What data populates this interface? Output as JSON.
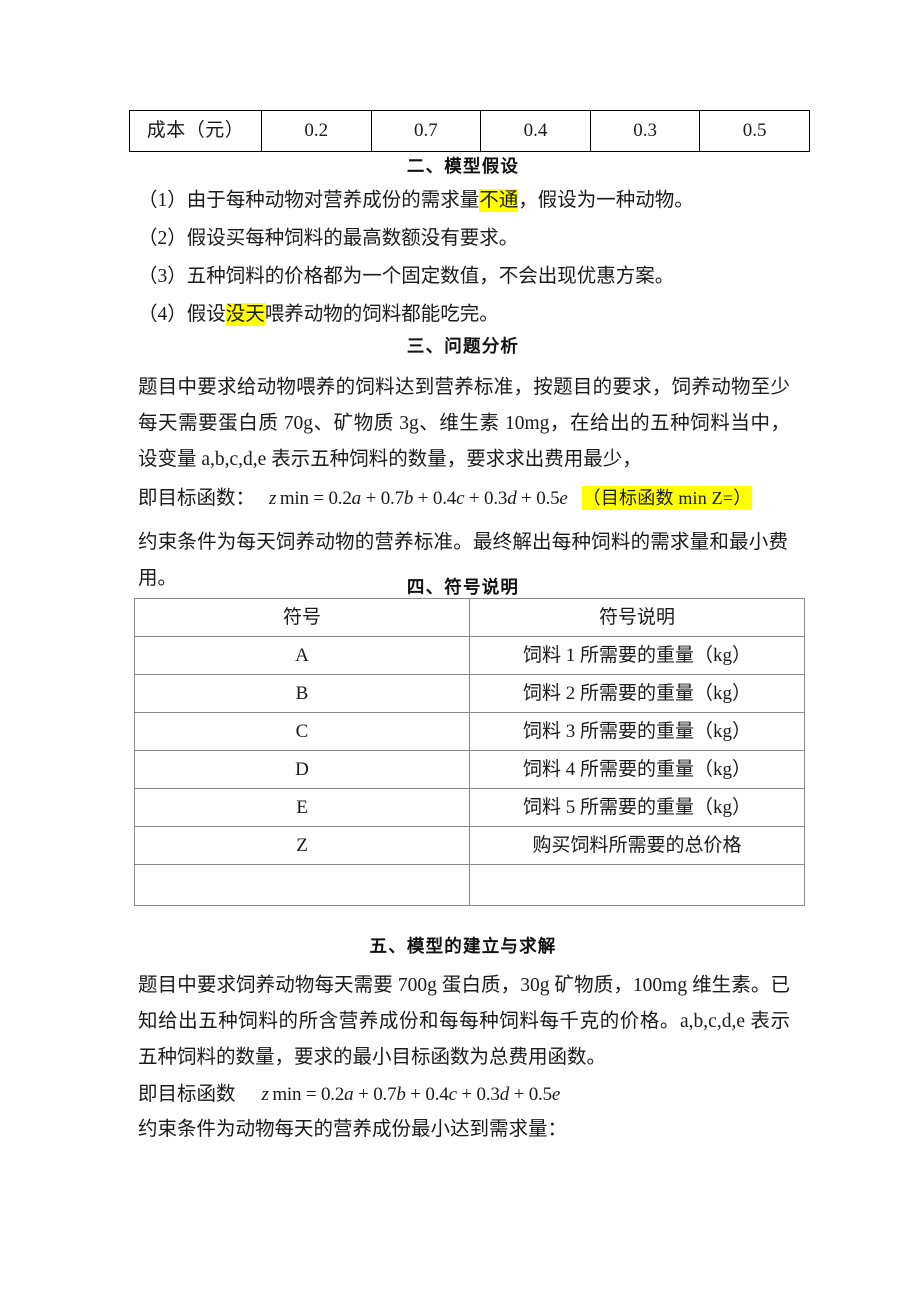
{
  "document": {
    "cost_table": {
      "row_label": "成本（元）",
      "values": [
        "0.2",
        "0.7",
        "0.4",
        "0.3",
        "0.5"
      ]
    },
    "sections": {
      "assumptions": {
        "heading": "二、模型假设",
        "items": [
          {
            "prefix": "（1）由于每种动物对营养成份的需求量",
            "highlight": "不通",
            "suffix": "，假设为一种动物。"
          },
          {
            "prefix": "（2）假设买每种饲料的最高数额没有要求。",
            "highlight": "",
            "suffix": ""
          },
          {
            "prefix": "（3）五种饲料的价格都为一个固定数值，不会出现优惠方案。",
            "highlight": "",
            "suffix": ""
          },
          {
            "prefix": "（4）假设",
            "highlight": "没天",
            "suffix": "喂养动物的饲料都能吃完。"
          }
        ]
      },
      "analysis": {
        "heading": "三、问题分析",
        "paragraph1": "题目中要求给动物喂养的饲料达到营养标准，按题目的要求，饲养动物至少每天需要蛋白质 70g、矿物质 3g、维生素 10mg，在给出的五种饲料当中，设变量 a,b,c,d,e 表示五种饲料的数量，要求求出费用最少，",
        "formula_label": "即目标函数：",
        "formula": "z min = 0.2a + 0.7b + 0.4c + 0.3d + 0.5e",
        "formula_note": "（目标函数    min Z=）",
        "paragraph2": "约束条件为每天饲养动物的营养标准。最终解出每种饲料的需求量和最小费用。"
      },
      "symbols": {
        "heading": "四、符号说明",
        "columns": [
          "符号",
          "符号说明"
        ],
        "rows": [
          {
            "symbol": "A",
            "description": "饲料 1 所需要的重量（kg）"
          },
          {
            "symbol": "B",
            "description": "饲料 2 所需要的重量（kg）"
          },
          {
            "symbol": "C",
            "description": "饲料 3 所需要的重量（kg）"
          },
          {
            "symbol": "D",
            "description": "饲料 4 所需要的重量（kg）"
          },
          {
            "symbol": "E",
            "description": "饲料 5 所需要的重量（kg）"
          },
          {
            "symbol": "Z",
            "description": "购买饲料所需要的总价格"
          },
          {
            "symbol": "",
            "description": ""
          }
        ]
      },
      "model": {
        "heading": "五、模型的建立与求解",
        "paragraph1": "题目中要求饲养动物每天需要 700g 蛋白质，30g 矿物质，100mg 维生素。已知给出五种饲料的所含营养成份和每每种饲料每千克的价格。a,b,c,d,e 表示五种饲料的数量，要求的最小目标函数为总费用函数。",
        "formula_label": "即目标函数",
        "formula": "z min = 0.2a + 0.7b + 0.4c + 0.3d + 0.5e",
        "paragraph2": "约束条件为动物每天的营养成份最小达到需求量："
      }
    },
    "colors": {
      "highlight": "#ffff00",
      "table_border_strong": "#000000",
      "table_border_light": "#888a8c",
      "text": "#1a1a1a"
    }
  }
}
